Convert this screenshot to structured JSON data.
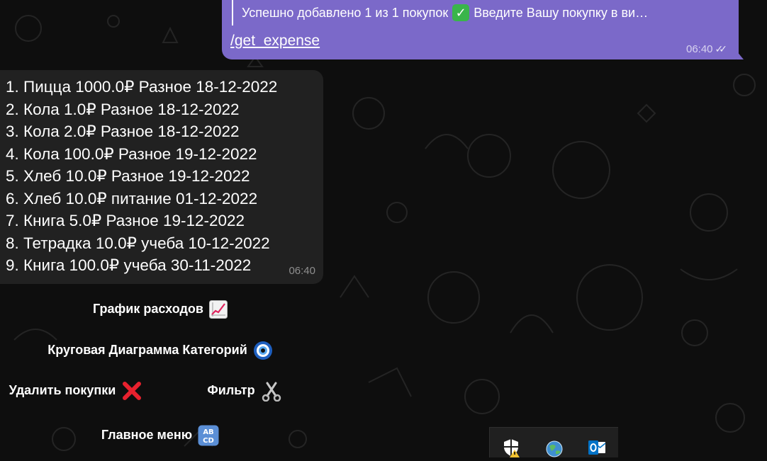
{
  "outgoing_message": {
    "reply_text": "Успешно добавлено 1 из 1 покупок",
    "reply_text_tail": "Введите Вашу покупку в ви…",
    "command": "/get_expense",
    "time": "06:40",
    "status_icon": "double-check-icon"
  },
  "incoming_message": {
    "lines": [
      "1. Пицца 1000.0₽ Разное 18-12-2022",
      "2. Кола 1.0₽ Разное 18-12-2022",
      "3. Кола 2.0₽ Разное 18-12-2022",
      "4. Кола 100.0₽ Разное 19-12-2022",
      "5. Хлеб 10.0₽ Разное 19-12-2022",
      "6. Хлеб 10.0₽ питание  01-12-2022",
      "7. Книга 5.0₽ Разное 19-12-2022",
      "8. Тетрадка 10.0₽ учеба  10-12-2022",
      "9. Книга 100.0₽ учеба  30-11-2022"
    ],
    "time": "06:40"
  },
  "keyboard": {
    "expense_chart": "График расходов",
    "category_pie": "Круговая Диаграмма Категорий",
    "delete_purchases": "Удалить покупки",
    "filter": "Фильтр",
    "main_menu": "Главное меню"
  },
  "tray_icons": [
    "shield-warning-icon",
    "globe-icon",
    "outlook-icon"
  ],
  "colors": {
    "background": "#0e0e0e",
    "outgoing_bubble": "#7b69c9",
    "incoming_bubble": "#212121",
    "time_muted": "#8e8e8e"
  }
}
